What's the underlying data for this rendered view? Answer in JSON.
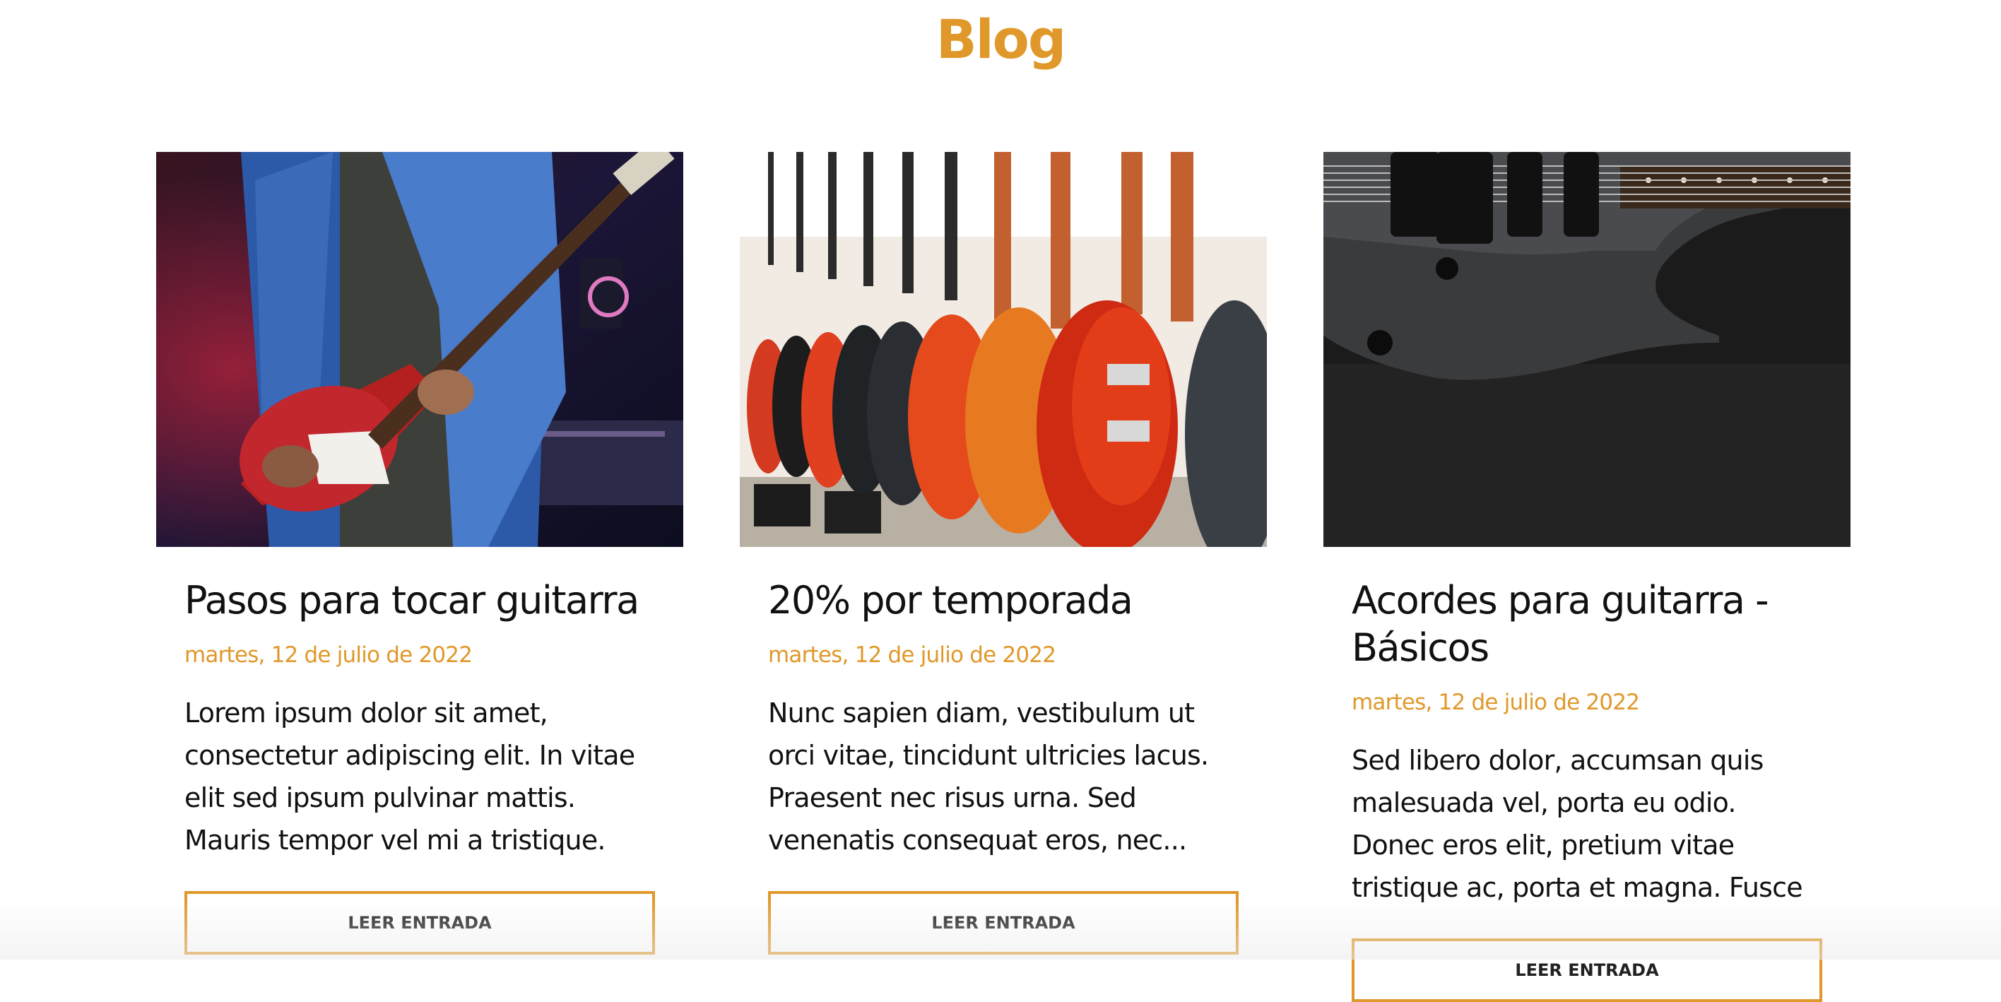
{
  "page": {
    "title": "Blog"
  },
  "colors": {
    "accent": "#e0982a",
    "text": "#111111",
    "background": "#ffffff"
  },
  "posts": [
    {
      "image": "guitarist-playing-red-electric-guitar-photo",
      "title": "Pasos para tocar guitarra",
      "date": "martes, 12 de julio de 2022",
      "excerpt": "Lorem ipsum dolor sit amet, consectetur adipiscing elit. In vitae elit sed ipsum pulvinar mattis. Mauris tempor vel mi a tristique. Vestibulu...",
      "button_label": "LEER ENTRADA"
    },
    {
      "image": "row-of-guitars-in-store-photo",
      "title": "20% por temporada",
      "date": "martes, 12 de julio de 2022",
      "excerpt": "Nunc sapien diam, vestibulum ut orci vitae, tincidunt ultricies lacus. Praesent nec risus urna. Sed venenatis consequat eros, nec...",
      "button_label": "LEER ENTRADA"
    },
    {
      "image": "black-electric-guitar-on-dark-surface-photo",
      "title": "Acordes para guitarra - Básicos",
      "date": "martes, 12 de julio de 2022",
      "excerpt": "Sed libero dolor, accumsan quis malesuada vel, porta eu odio. Donec eros elit, pretium vitae tristique ac, porta et magna. Fusce eu pretium...",
      "button_label": "LEER ENTRADA"
    }
  ]
}
